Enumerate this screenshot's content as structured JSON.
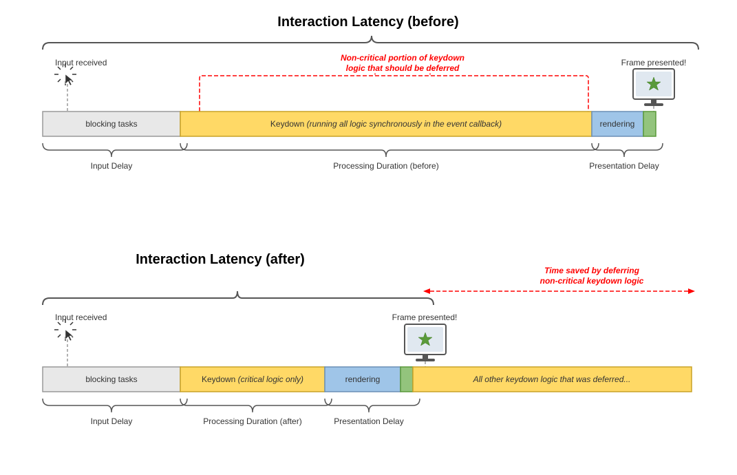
{
  "top": {
    "title": "Interaction Latency (before)",
    "input_received": "Input received",
    "frame_presented": "Frame presented!",
    "red_annotation_line1": "Non-critical portion of keydown",
    "red_annotation_line2": "logic that should be deferred",
    "blocking_tasks": "blocking tasks",
    "keydown_label": "Keydown (running all logic synchronously in the event callback)",
    "rendering": "rendering",
    "input_delay": "Input Delay",
    "processing_duration": "Processing Duration (before)",
    "presentation_delay": "Presentation Delay"
  },
  "bottom": {
    "title": "Interaction Latency (after)",
    "time_saved_line1": "Time saved by deferring",
    "time_saved_line2": "non-critical keydown logic",
    "input_received": "Input received",
    "frame_presented": "Frame presented!",
    "blocking_tasks": "blocking tasks",
    "keydown_label": "Keydown (critical logic only)",
    "rendering": "rendering",
    "deferred_label": "All other keydown logic that was deferred...",
    "input_delay": "Input Delay",
    "processing_duration": "Processing Duration (after)",
    "presentation_delay": "Presentation Delay"
  }
}
